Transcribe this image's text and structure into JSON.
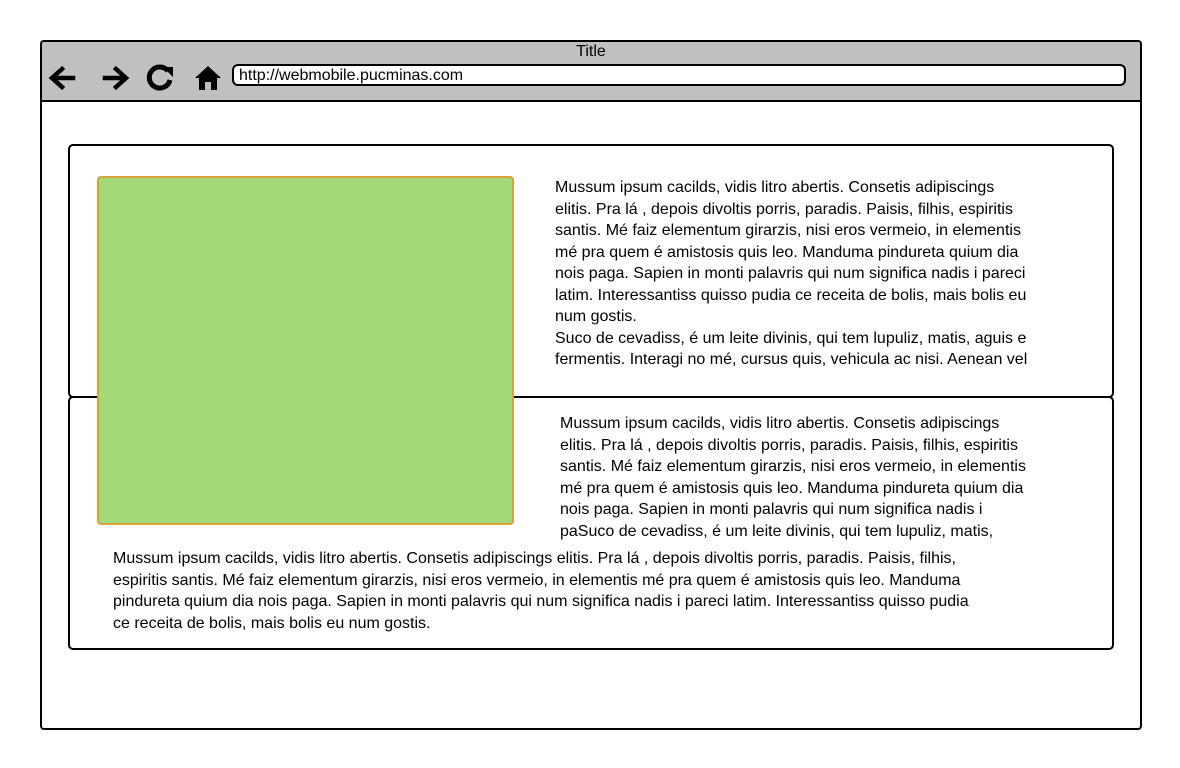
{
  "window": {
    "title": "Title",
    "address_url": "http://webmobile.pucminas.com"
  },
  "toolbar": {
    "icons": [
      "back-arrow-icon",
      "forward-arrow-icon",
      "reload-icon",
      "home-icon"
    ]
  },
  "content": {
    "top_paragraph": [
      "Mussum ipsum cacilds, vidis litro abertis. Consetis adipiscings",
      "elitis. Pra lá , depois divoltis porris, paradis. Paisis, filhis, espiritis",
      "santis. Mé faiz elementum girarzis, nisi eros vermeio, in elementis",
      "mé pra quem é amistosis quis leo. Manduma pindureta quium dia",
      "nois paga. Sapien in monti palavris qui num significa nadis i pareci",
      "latim. Interessantiss quisso pudia ce receita de bolis, mais bolis eu",
      "num gostis.",
      "Suco de cevadiss, é um leite divinis, qui tem lupuliz, matis, aguis e",
      "fermentis. Interagi no mé, cursus quis, vehicula ac nisi. Aenean vel"
    ],
    "middle_paragraph": [
      "Mussum ipsum cacilds, vidis litro abertis. Consetis adipiscings",
      "elitis. Pra lá , depois divoltis porris, paradis. Paisis, filhis, espiritis",
      "santis. Mé faiz elementum girarzis, nisi eros vermeio, in elementis",
      "mé pra quem é amistosis quis leo. Manduma pindureta quium dia",
      "nois paga. Sapien in monti palavris qui num significa nadis i",
      "paSuco de cevadiss, é um leite divinis, qui tem lupuliz, matis,"
    ],
    "bottom_paragraph": [
      "Mussum ipsum cacilds, vidis litro abertis. Consetis adipiscings elitis. Pra lá , depois divoltis porris, paradis. Paisis, filhis,",
      "espiritis santis. Mé faiz elementum girarzis, nisi eros vermeio, in elementis mé pra quem é amistosis quis leo. Manduma",
      "pindureta quium dia nois paga. Sapien in monti palavris qui num significa nadis i pareci latim. Interessantiss quisso pudia",
      "ce receita de bolis, mais bolis eu num gostis."
    ]
  },
  "colors": {
    "titlebar": "#c0c0c0",
    "image_fill": "#a3d977",
    "image_border": "#d6a23c"
  }
}
